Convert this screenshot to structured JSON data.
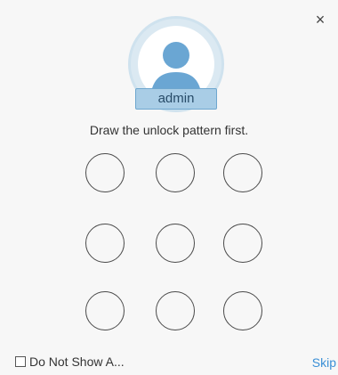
{
  "dialog": {
    "close_glyph": "×",
    "user": {
      "username": "admin",
      "avatar_icon": "user-silhouette-icon"
    },
    "prompt": "Draw the unlock pattern first.",
    "pattern": {
      "rows": 3,
      "cols": 3,
      "dots": 9
    },
    "footer": {
      "checkbox_label": "Do Not Show A...",
      "checkbox_checked": false,
      "skip_label": "Skip"
    },
    "colors": {
      "accent": "#3a8fd6",
      "avatar": "#6aa6d3",
      "badge_bg": "#a9cde6",
      "badge_border": "#6ea7cf"
    }
  }
}
